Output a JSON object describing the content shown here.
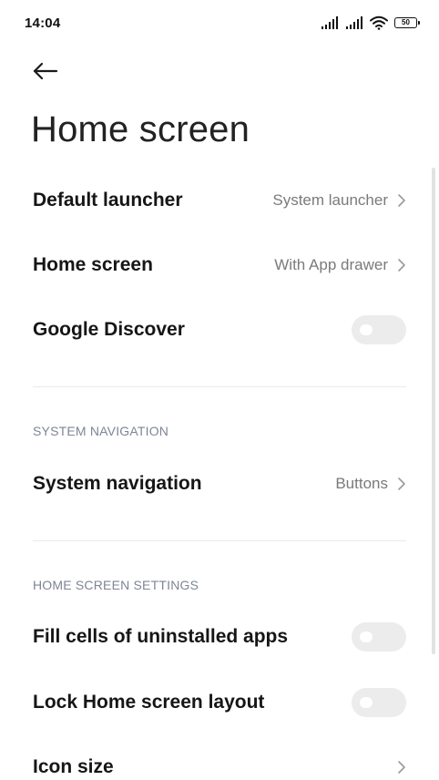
{
  "status_bar": {
    "time": "14:04",
    "battery_level": "50"
  },
  "page": {
    "title": "Home screen"
  },
  "settings": {
    "default_launcher": {
      "label": "Default launcher",
      "value": "System launcher"
    },
    "home_screen": {
      "label": "Home screen",
      "value": "With App drawer"
    },
    "google_discover": {
      "label": "Google Discover",
      "enabled": false
    }
  },
  "system_navigation_section": {
    "header": "SYSTEM NAVIGATION",
    "system_navigation": {
      "label": "System navigation",
      "value": "Buttons"
    }
  },
  "home_screen_settings_section": {
    "header": "HOME SCREEN SETTINGS",
    "fill_cells": {
      "label": "Fill cells of uninstalled apps",
      "enabled": false
    },
    "lock_layout": {
      "label": "Lock Home screen layout",
      "enabled": false
    },
    "icon_size": {
      "label": "Icon size"
    }
  },
  "icons": {
    "back": "arrow-left-icon",
    "chevron": "chevron-right-icon",
    "signal": "cellular-signal-icon",
    "wifi": "wifi-icon",
    "battery": "battery-icon"
  },
  "colors": {
    "background": "#ffffff",
    "label": "#161616",
    "value": "#7a7a7a",
    "section_header": "#7e8596",
    "toggle_off": "#ececec"
  }
}
